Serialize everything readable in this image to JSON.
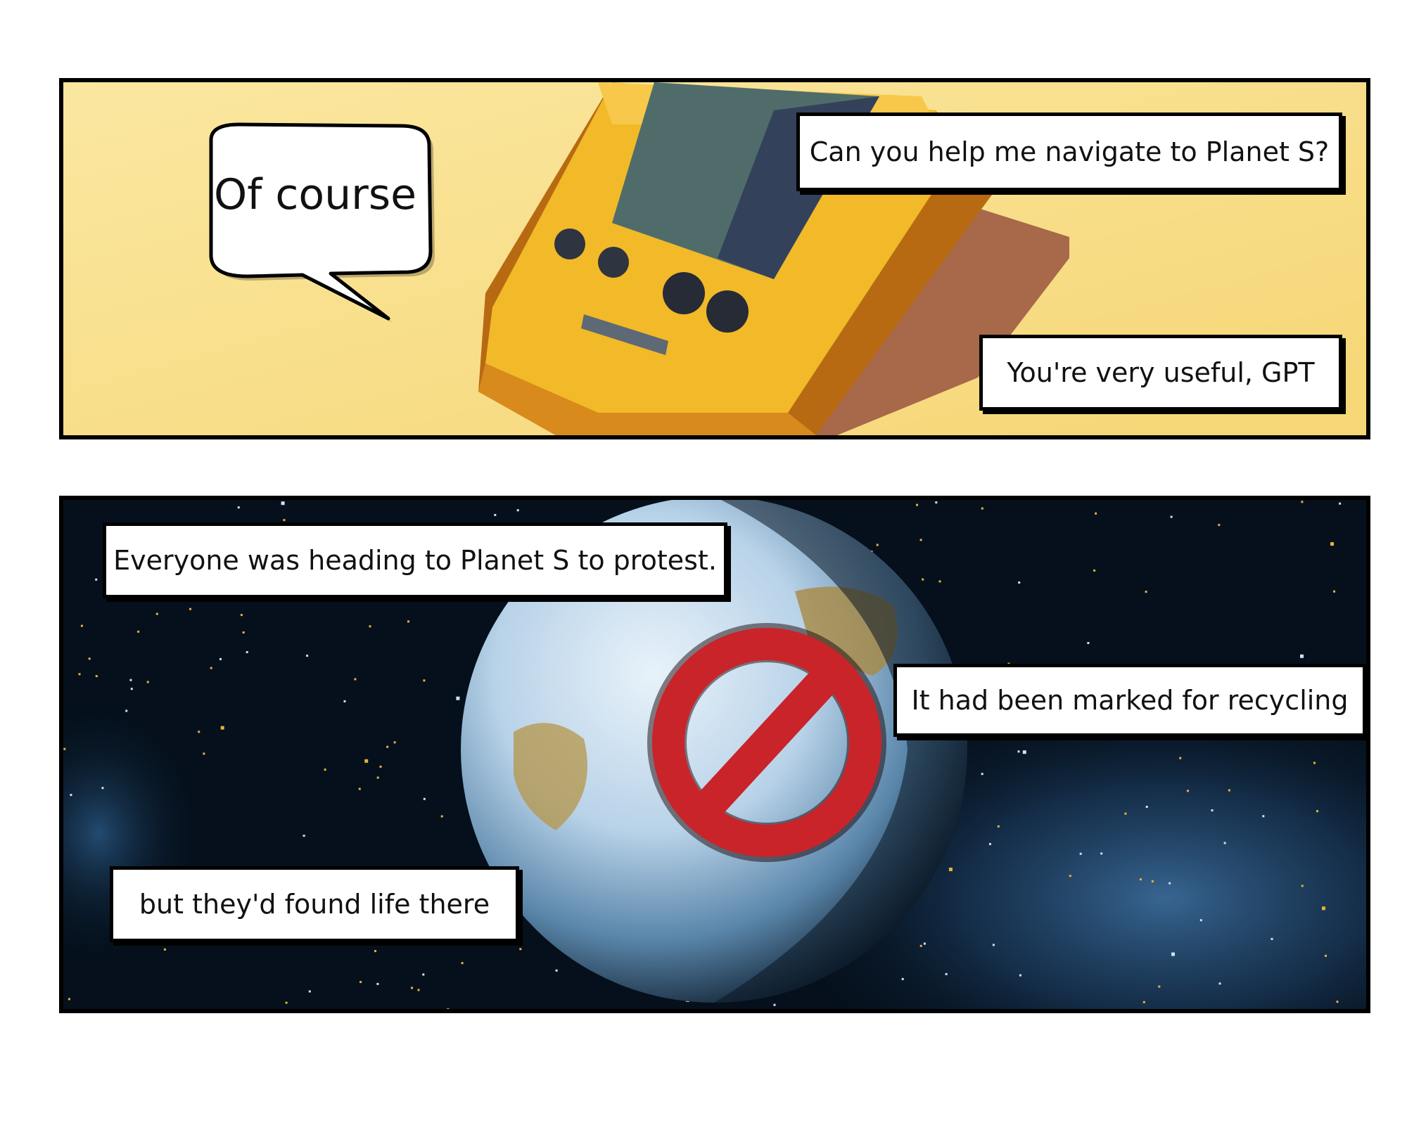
{
  "panels": {
    "top": {
      "speech_bubble": "Of course",
      "caption_question": "Can you help me navigate to Planet S?",
      "caption_praise": "You're very useful, GPT"
    },
    "bottom": {
      "caption_heading": "Everyone was heading to Planet S to protest.",
      "caption_recycling": "It had been marked for recycling",
      "caption_life": "but they'd found life there"
    }
  },
  "colors": {
    "top_background": "#f8df8c",
    "device_yellow": "#f2b928",
    "device_screen": "#4f6c6a",
    "space_background": "#05101c",
    "prohibition_red": "#c8242a"
  },
  "icons": {
    "top": "handheld-game-device",
    "bottom": "prohibition-sign"
  }
}
